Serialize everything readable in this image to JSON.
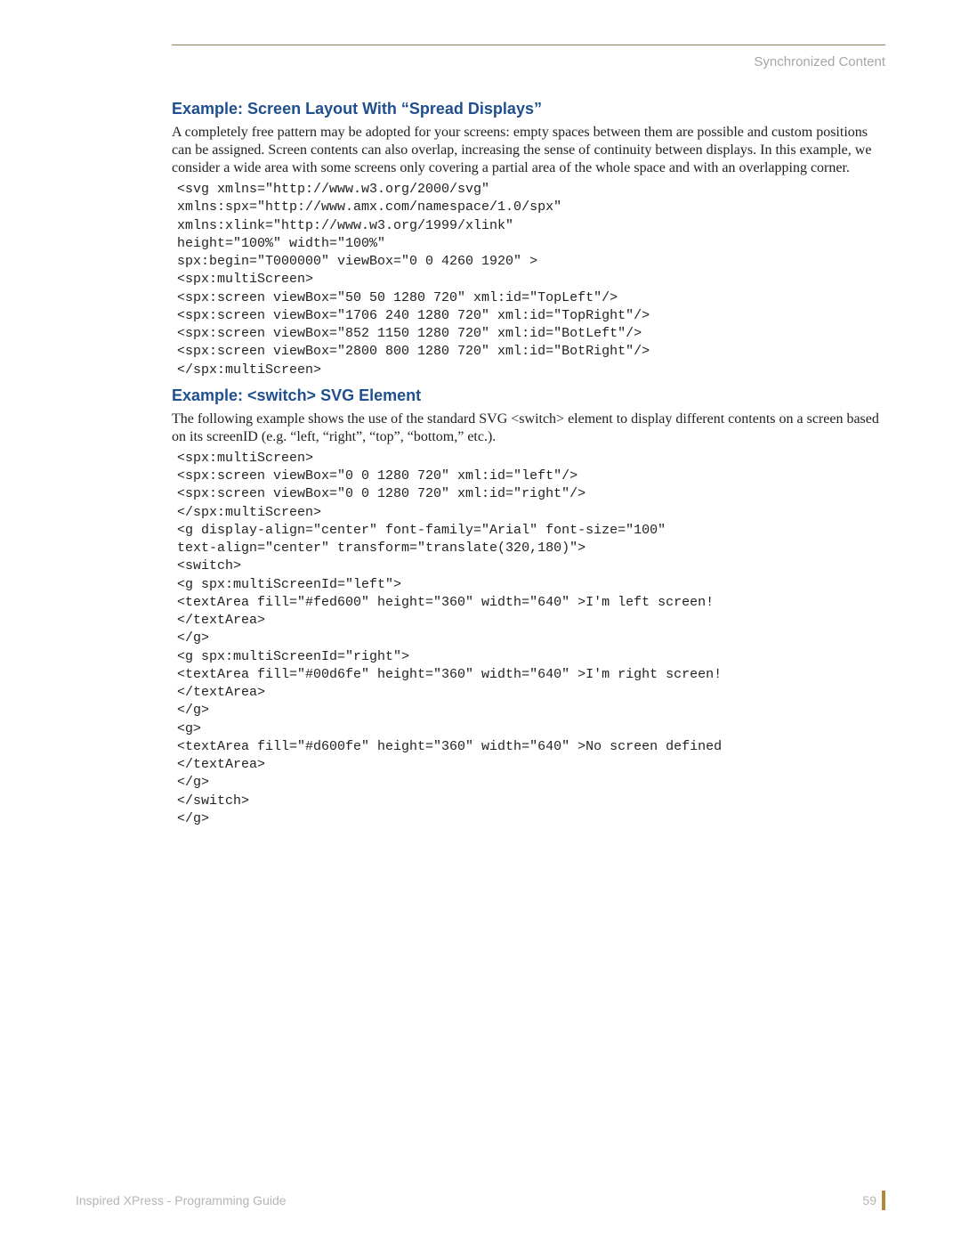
{
  "header": {
    "right": "Synchronized Content"
  },
  "section1": {
    "title": "Example: Screen Layout With “Spread Displays”",
    "paragraph": "A completely free pattern may be adopted for your screens: empty spaces between them are possible and custom positions can be assigned. Screen contents can also overlap, increasing the sense of continuity between displays. In this example, we consider a wide area with some screens only covering a partial area of the whole space and with an overlapping corner.",
    "code": "<svg xmlns=\"http://www.w3.org/2000/svg\"\nxmlns:spx=\"http://www.amx.com/namespace/1.0/spx\"\nxmlns:xlink=\"http://www.w3.org/1999/xlink\"\nheight=\"100%\" width=\"100%\"\nspx:begin=\"T000000\" viewBox=\"0 0 4260 1920\" >\n<spx:multiScreen>\n<spx:screen viewBox=\"50 50 1280 720\" xml:id=\"TopLeft\"/>\n<spx:screen viewBox=\"1706 240 1280 720\" xml:id=\"TopRight\"/>\n<spx:screen viewBox=\"852 1150 1280 720\" xml:id=\"BotLeft\"/>\n<spx:screen viewBox=\"2800 800 1280 720\" xml:id=\"BotRight\"/>\n</spx:multiScreen>"
  },
  "section2": {
    "title": "Example: <switch> SVG Element",
    "paragraph": "The following example shows the use of the standard SVG <switch> element to display different contents on a screen based on its screenID (e.g. “left, “right”, “top”, “bottom,” etc.).",
    "code": "<spx:multiScreen>\n<spx:screen viewBox=\"0 0 1280 720\" xml:id=\"left\"/>\n<spx:screen viewBox=\"0 0 1280 720\" xml:id=\"right\"/>\n</spx:multiScreen>\n<g display-align=\"center\" font-family=\"Arial\" font-size=\"100\"\ntext-align=\"center\" transform=\"translate(320,180)\">\n<switch>\n<g spx:multiScreenId=\"left\">\n<textArea fill=\"#fed600\" height=\"360\" width=\"640\" >I'm left screen!\n</textArea>\n</g>\n<g spx:multiScreenId=\"right\">\n<textArea fill=\"#00d6fe\" height=\"360\" width=\"640\" >I'm right screen!\n</textArea>\n</g>\n<g>\n<textArea fill=\"#d600fe\" height=\"360\" width=\"640\" >No screen defined\n</textArea>\n</g>\n</switch>\n</g>"
  },
  "footer": {
    "left": "Inspired XPress - Programming Guide",
    "page": "59"
  }
}
